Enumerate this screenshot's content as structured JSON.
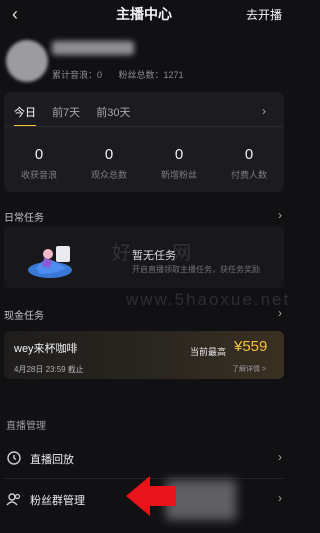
{
  "header": {
    "back_icon": "chevron-left-icon",
    "title": "主播中心",
    "action": "去开播"
  },
  "profile": {
    "stats": [
      "累计音浪：0",
      "粉丝总数：1271"
    ]
  },
  "period_tabs": {
    "items": [
      "今日",
      "前7天",
      "前30天"
    ],
    "active": 0,
    "accent": "#f6c23a"
  },
  "metrics": [
    {
      "value": "0",
      "label": "收获音浪"
    },
    {
      "value": "0",
      "label": "观众总数"
    },
    {
      "value": "0",
      "label": "新增粉丝"
    },
    {
      "value": "0",
      "label": "付费人数"
    }
  ],
  "daily_task": {
    "title": "日常任务",
    "empty_title": "暂无任务",
    "empty_sub": "开启直播领取主播任务，获任务奖励",
    "watermark": [
      "好",
      "网"
    ],
    "watermark_url": "www.5haoxue.net"
  },
  "cash_task": {
    "title": "现金任务",
    "name": "wey来杯咖啡",
    "date": "4月28日 23:59 截止",
    "max_label": "当前最高",
    "amount": "¥559",
    "detail": "了解详情 >"
  },
  "live_management": {
    "title": "直播管理",
    "items": [
      {
        "label": "直播回放",
        "icon": "replay-icon"
      },
      {
        "label": "粉丝群管理",
        "icon": "fan-group-icon"
      }
    ]
  }
}
